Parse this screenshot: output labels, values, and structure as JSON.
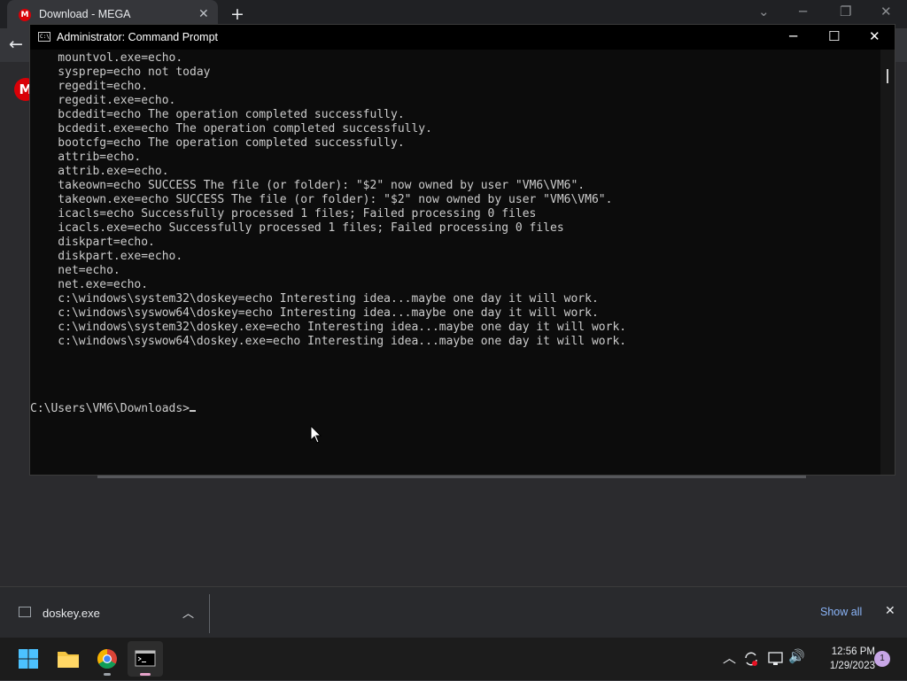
{
  "browser": {
    "tab_title": "Download - MEGA",
    "tab_favicon": "M",
    "tab_close": "✕",
    "new_tab": "+",
    "back": "←",
    "logo_letter": "M",
    "min": "─",
    "restore": "❐",
    "close": "✕",
    "tab_search": "⌄"
  },
  "cmd": {
    "title": "Administrator: Command Prompt",
    "icon_text": "C:\\",
    "minimize": "─",
    "maximize": "☐",
    "close": "✕",
    "lines": [
      "    mountvol.exe=echo.",
      "    sysprep=echo not today",
      "    regedit=echo.",
      "    regedit.exe=echo.",
      "    bcdedit=echo The operation completed successfully.",
      "    bcdedit.exe=echo The operation completed successfully.",
      "    bootcfg=echo The operation completed successfully.",
      "    attrib=echo.",
      "    attrib.exe=echo.",
      "    takeown=echo SUCCESS The file (or folder): \"$2\" now owned by user \"VM6\\VM6\".",
      "    takeown.exe=echo SUCCESS The file (or folder): \"$2\" now owned by user \"VM6\\VM6\".",
      "    icacls=echo Successfully processed 1 files; Failed processing 0 files",
      "    icacls.exe=echo Successfully processed 1 files; Failed processing 0 files",
      "    diskpart=echo.",
      "    diskpart.exe=echo.",
      "    net=echo.",
      "    net.exe=echo.",
      "    c:\\windows\\system32\\doskey=echo Interesting idea...maybe one day it will work.",
      "    c:\\windows\\syswow64\\doskey=echo Interesting idea...maybe one day it will work.",
      "    c:\\windows\\system32\\doskey.exe=echo Interesting idea...maybe one day it will work.",
      "    c:\\windows\\syswow64\\doskey.exe=echo Interesting idea...maybe one day it will work."
    ],
    "prompt": "C:\\Users\\VM6\\Downloads>"
  },
  "download_shelf": {
    "file_name": "doskey.exe",
    "chevron": "︿",
    "show_all": "Show all",
    "close": "✕"
  },
  "taskbar": {
    "time": "12:56 PM",
    "date": "1/29/2023",
    "notification_count": "1",
    "tray_chevron": "︿",
    "volume": "🔊"
  }
}
